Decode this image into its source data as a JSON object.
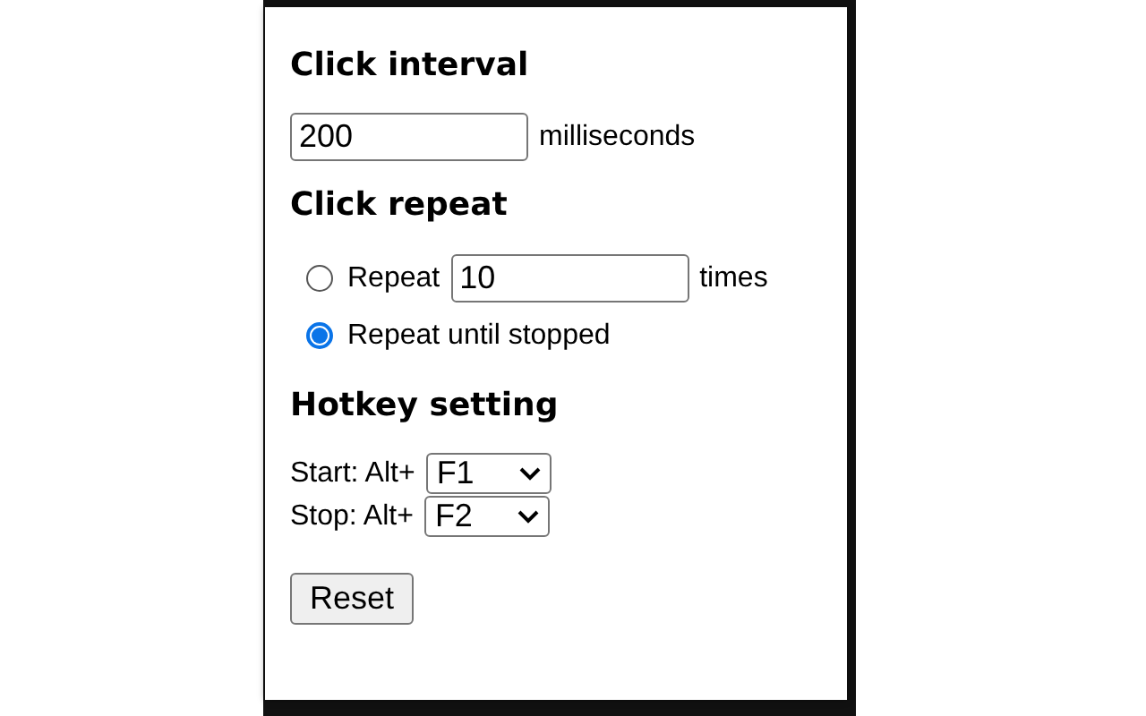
{
  "interval": {
    "heading": "Click interval",
    "value": "200",
    "unit": "milliseconds"
  },
  "repeat": {
    "heading": "Click repeat",
    "options": [
      {
        "kind": "count",
        "label": "Repeat",
        "value": "10",
        "unit": "times",
        "selected": false
      },
      {
        "kind": "plain",
        "label": "Repeat until stopped",
        "selected": true
      }
    ]
  },
  "hotkeys": {
    "heading": "Hotkey setting",
    "rows": [
      {
        "label": "Start: Alt+",
        "value": "F1"
      },
      {
        "label": "Stop: Alt+",
        "value": "F2"
      }
    ]
  },
  "reset_button": "Reset"
}
